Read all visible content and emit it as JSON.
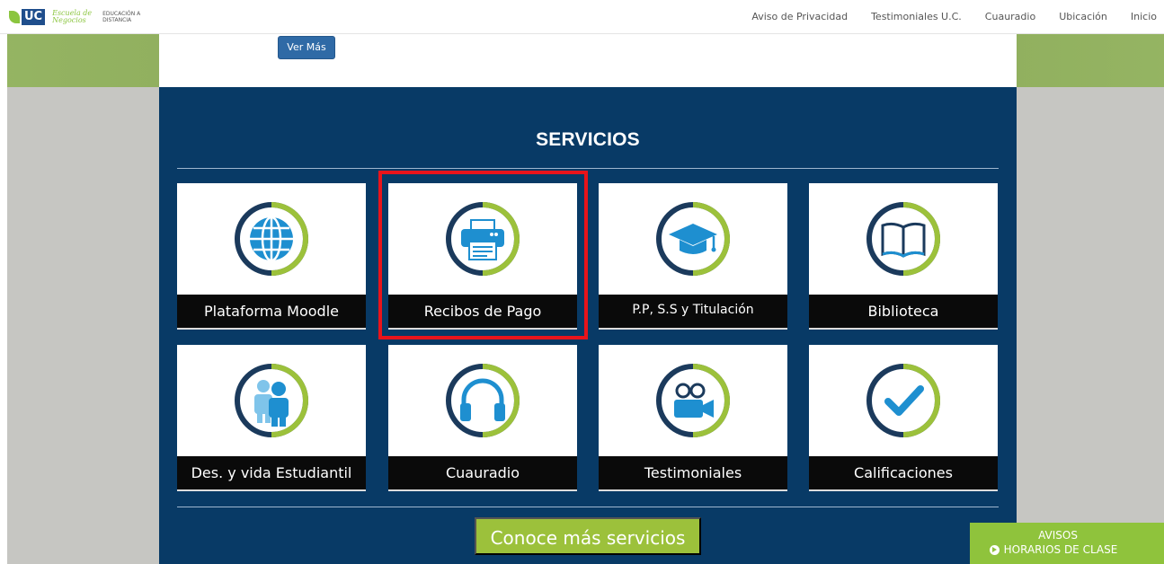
{
  "header": {
    "logo_uc": "UC",
    "logo_escuela": "Escuela de Negocios",
    "logo_distancia": "EDUCACIÓN A DISTANCIA",
    "nav": [
      "Aviso de Privacidad",
      "Testimoniales U.C.",
      "Cuauradio",
      "Ubicación",
      "Inicio"
    ]
  },
  "content": {
    "ver_mas_label": "Ver Más"
  },
  "services": {
    "title": "SERVICIOS",
    "items": [
      {
        "label": "Plataforma Moodle",
        "icon": "globe-icon"
      },
      {
        "label": "Recibos de Pago",
        "icon": "printer-icon"
      },
      {
        "label": "P.P, S.S y Titulación",
        "icon": "graduation-cap-icon"
      },
      {
        "label": "Biblioteca",
        "icon": "book-icon"
      },
      {
        "label": "Des. y vida Estudiantil",
        "icon": "people-icon"
      },
      {
        "label": "Cuauradio",
        "icon": "headphones-icon"
      },
      {
        "label": "Testimoniales",
        "icon": "video-camera-icon"
      },
      {
        "label": "Calificaciones",
        "icon": "checkmark-icon"
      }
    ],
    "more_label": "Conoce más servicios",
    "highlighted_item": "Recibos de Pago"
  },
  "avisos": {
    "title": "AVISOS",
    "link": "HORARIOS DE CLASE"
  },
  "colors": {
    "panel": "#083a66",
    "accent_green": "#9cc13b",
    "icon_blue": "#1e8fd0",
    "ring_dark": "#1b3a5c",
    "ring_green": "#9cc13b",
    "highlight": "#e8141b"
  }
}
